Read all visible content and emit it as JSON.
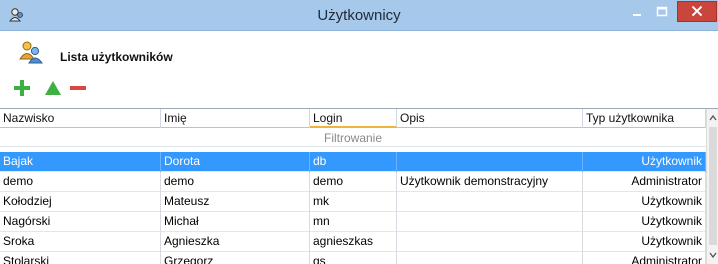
{
  "window": {
    "title": "Użytkownicy",
    "accent": "#a6c8ea",
    "close_color": "#c9463d"
  },
  "header": {
    "title": "Lista użytkowników",
    "icon": "users-icon"
  },
  "toolbar": {
    "buttons": [
      {
        "name": "add",
        "icon": "plus-icon",
        "color": "#3cb043"
      },
      {
        "name": "edit",
        "icon": "triangle-icon",
        "color": "#3cb043"
      },
      {
        "name": "delete",
        "icon": "minus-icon",
        "color": "#d9473f"
      }
    ]
  },
  "table": {
    "columns": [
      "Nazwisko",
      "Imię",
      "Login",
      "Opis",
      "Typ użytkownika"
    ],
    "sorted_column": "Login",
    "filter_label": "Filtrowanie",
    "selected_row": 0,
    "selection_color": "#3399ff",
    "rows": [
      [
        "Bajak",
        "Dorota",
        "db",
        "",
        "Użytkownik"
      ],
      [
        "demo",
        "demo",
        "demo",
        "Użytkownik demonstracyjny",
        "Administrator"
      ],
      [
        "Kołodziej",
        "Mateusz",
        "mk",
        "",
        "Użytkownik"
      ],
      [
        "Nagórski",
        "Michał",
        "mn",
        "",
        "Użytkownik"
      ],
      [
        "Sroka",
        "Agnieszka",
        "agnieszkas",
        "",
        "Użytkownik"
      ],
      [
        "Stolarski",
        "Grzegorz",
        "gs",
        "",
        "Administrator"
      ]
    ]
  }
}
